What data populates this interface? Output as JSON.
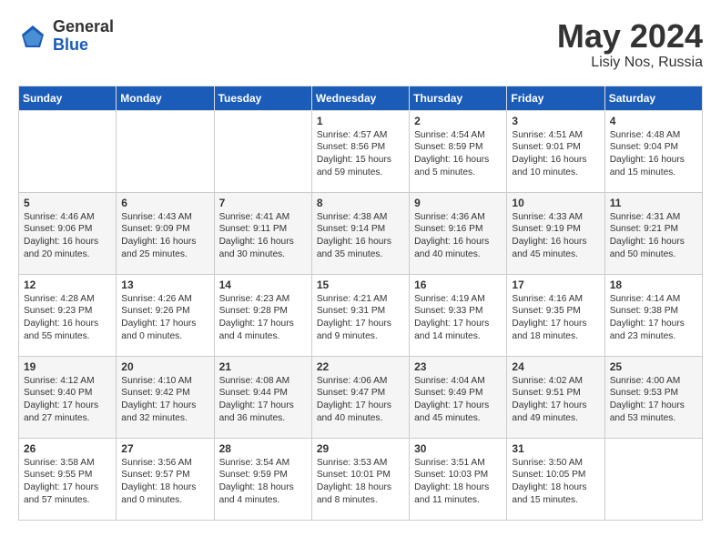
{
  "header": {
    "logo_general": "General",
    "logo_blue": "Blue",
    "month": "May 2024",
    "location": "Lisiy Nos, Russia"
  },
  "days_of_week": [
    "Sunday",
    "Monday",
    "Tuesday",
    "Wednesday",
    "Thursday",
    "Friday",
    "Saturday"
  ],
  "weeks": [
    [
      {
        "day": "",
        "content": ""
      },
      {
        "day": "",
        "content": ""
      },
      {
        "day": "",
        "content": ""
      },
      {
        "day": "1",
        "content": "Sunrise: 4:57 AM\nSunset: 8:56 PM\nDaylight: 15 hours\nand 59 minutes."
      },
      {
        "day": "2",
        "content": "Sunrise: 4:54 AM\nSunset: 8:59 PM\nDaylight: 16 hours\nand 5 minutes."
      },
      {
        "day": "3",
        "content": "Sunrise: 4:51 AM\nSunset: 9:01 PM\nDaylight: 16 hours\nand 10 minutes."
      },
      {
        "day": "4",
        "content": "Sunrise: 4:48 AM\nSunset: 9:04 PM\nDaylight: 16 hours\nand 15 minutes."
      }
    ],
    [
      {
        "day": "5",
        "content": "Sunrise: 4:46 AM\nSunset: 9:06 PM\nDaylight: 16 hours\nand 20 minutes."
      },
      {
        "day": "6",
        "content": "Sunrise: 4:43 AM\nSunset: 9:09 PM\nDaylight: 16 hours\nand 25 minutes."
      },
      {
        "day": "7",
        "content": "Sunrise: 4:41 AM\nSunset: 9:11 PM\nDaylight: 16 hours\nand 30 minutes."
      },
      {
        "day": "8",
        "content": "Sunrise: 4:38 AM\nSunset: 9:14 PM\nDaylight: 16 hours\nand 35 minutes."
      },
      {
        "day": "9",
        "content": "Sunrise: 4:36 AM\nSunset: 9:16 PM\nDaylight: 16 hours\nand 40 minutes."
      },
      {
        "day": "10",
        "content": "Sunrise: 4:33 AM\nSunset: 9:19 PM\nDaylight: 16 hours\nand 45 minutes."
      },
      {
        "day": "11",
        "content": "Sunrise: 4:31 AM\nSunset: 9:21 PM\nDaylight: 16 hours\nand 50 minutes."
      }
    ],
    [
      {
        "day": "12",
        "content": "Sunrise: 4:28 AM\nSunset: 9:23 PM\nDaylight: 16 hours\nand 55 minutes."
      },
      {
        "day": "13",
        "content": "Sunrise: 4:26 AM\nSunset: 9:26 PM\nDaylight: 17 hours\nand 0 minutes."
      },
      {
        "day": "14",
        "content": "Sunrise: 4:23 AM\nSunset: 9:28 PM\nDaylight: 17 hours\nand 4 minutes."
      },
      {
        "day": "15",
        "content": "Sunrise: 4:21 AM\nSunset: 9:31 PM\nDaylight: 17 hours\nand 9 minutes."
      },
      {
        "day": "16",
        "content": "Sunrise: 4:19 AM\nSunset: 9:33 PM\nDaylight: 17 hours\nand 14 minutes."
      },
      {
        "day": "17",
        "content": "Sunrise: 4:16 AM\nSunset: 9:35 PM\nDaylight: 17 hours\nand 18 minutes."
      },
      {
        "day": "18",
        "content": "Sunrise: 4:14 AM\nSunset: 9:38 PM\nDaylight: 17 hours\nand 23 minutes."
      }
    ],
    [
      {
        "day": "19",
        "content": "Sunrise: 4:12 AM\nSunset: 9:40 PM\nDaylight: 17 hours\nand 27 minutes."
      },
      {
        "day": "20",
        "content": "Sunrise: 4:10 AM\nSunset: 9:42 PM\nDaylight: 17 hours\nand 32 minutes."
      },
      {
        "day": "21",
        "content": "Sunrise: 4:08 AM\nSunset: 9:44 PM\nDaylight: 17 hours\nand 36 minutes."
      },
      {
        "day": "22",
        "content": "Sunrise: 4:06 AM\nSunset: 9:47 PM\nDaylight: 17 hours\nand 40 minutes."
      },
      {
        "day": "23",
        "content": "Sunrise: 4:04 AM\nSunset: 9:49 PM\nDaylight: 17 hours\nand 45 minutes."
      },
      {
        "day": "24",
        "content": "Sunrise: 4:02 AM\nSunset: 9:51 PM\nDaylight: 17 hours\nand 49 minutes."
      },
      {
        "day": "25",
        "content": "Sunrise: 4:00 AM\nSunset: 9:53 PM\nDaylight: 17 hours\nand 53 minutes."
      }
    ],
    [
      {
        "day": "26",
        "content": "Sunrise: 3:58 AM\nSunset: 9:55 PM\nDaylight: 17 hours\nand 57 minutes."
      },
      {
        "day": "27",
        "content": "Sunrise: 3:56 AM\nSunset: 9:57 PM\nDaylight: 18 hours\nand 0 minutes."
      },
      {
        "day": "28",
        "content": "Sunrise: 3:54 AM\nSunset: 9:59 PM\nDaylight: 18 hours\nand 4 minutes."
      },
      {
        "day": "29",
        "content": "Sunrise: 3:53 AM\nSunset: 10:01 PM\nDaylight: 18 hours\nand 8 minutes."
      },
      {
        "day": "30",
        "content": "Sunrise: 3:51 AM\nSunset: 10:03 PM\nDaylight: 18 hours\nand 11 minutes."
      },
      {
        "day": "31",
        "content": "Sunrise: 3:50 AM\nSunset: 10:05 PM\nDaylight: 18 hours\nand 15 minutes."
      },
      {
        "day": "",
        "content": ""
      }
    ]
  ]
}
